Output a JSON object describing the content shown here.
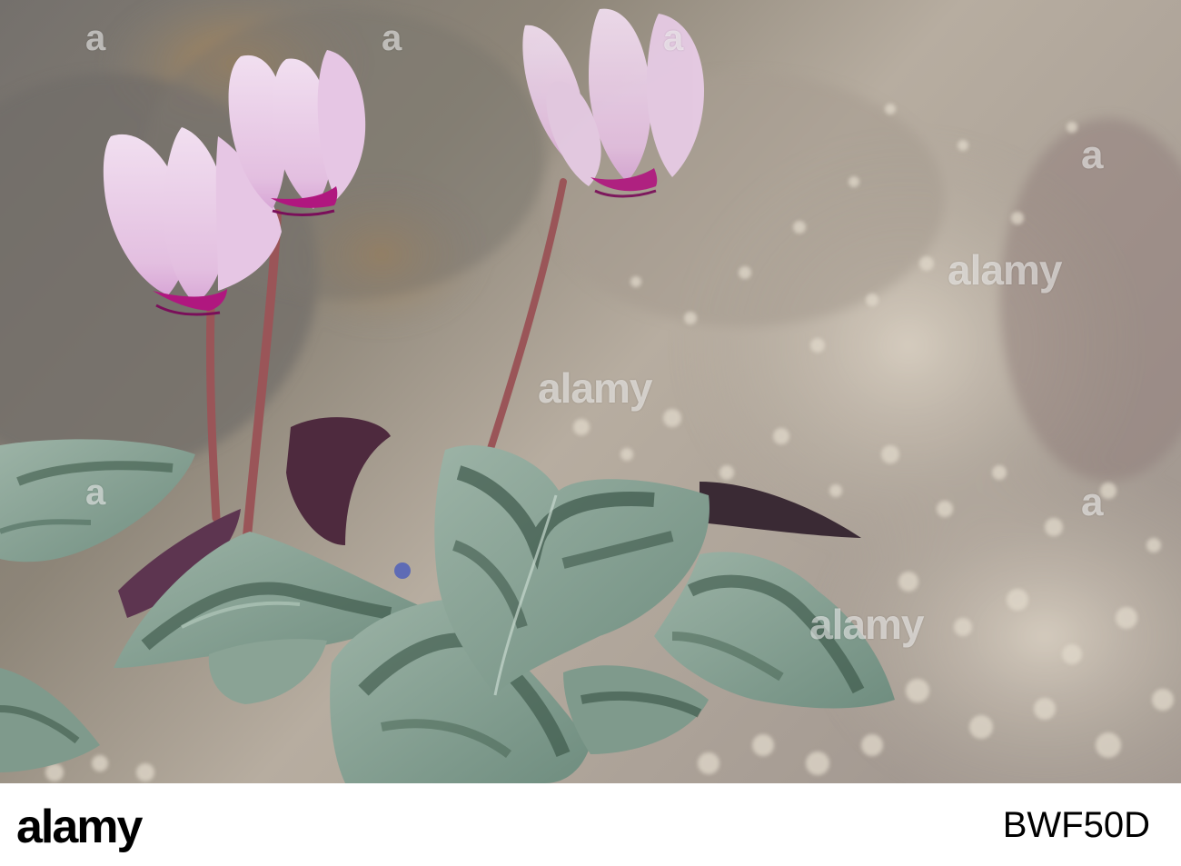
{
  "photo": {
    "subject": "cyclamen-plant",
    "colors": {
      "petal": "#e8c8e6",
      "petal_base": "#b0177f",
      "leaf": "#8fa69a",
      "leaf_dark": "#3d5a4a",
      "stem": "#9a5558",
      "gravel": "#c8bfb0",
      "rock": "#8a8580"
    },
    "watermarks": [
      {
        "text": "alamy"
      },
      {
        "text": "alamy"
      },
      {
        "text": "alamy"
      },
      {
        "text": "a"
      },
      {
        "text": "a"
      },
      {
        "text": "a"
      },
      {
        "text": "a"
      },
      {
        "text": "a"
      },
      {
        "text": "a"
      }
    ]
  },
  "footer": {
    "logo": "alamy",
    "image_id": "BWF50D"
  }
}
